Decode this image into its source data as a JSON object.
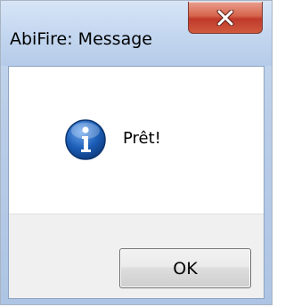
{
  "window": {
    "title": "AbiFire: Message",
    "close_icon": "close-icon"
  },
  "dialog": {
    "icon": "info-icon",
    "message": "Prêt!",
    "ok_label": "OK"
  },
  "colors": {
    "close_button": "#c0392b",
    "info_icon": "#1d5fb8"
  }
}
